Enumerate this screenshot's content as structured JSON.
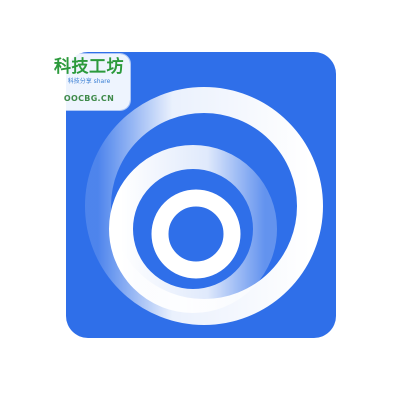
{
  "icon": {
    "name": "ring-logo-icon",
    "background_color": "#2f6fe9",
    "ring_color": "#ffffff"
  },
  "watermark": {
    "title": "科技工坊",
    "subtitle": "科技分享 share",
    "domain": "OOCBG.CN",
    "title_color": "#2c9a3c",
    "domain_color": "#3f8a4a"
  }
}
